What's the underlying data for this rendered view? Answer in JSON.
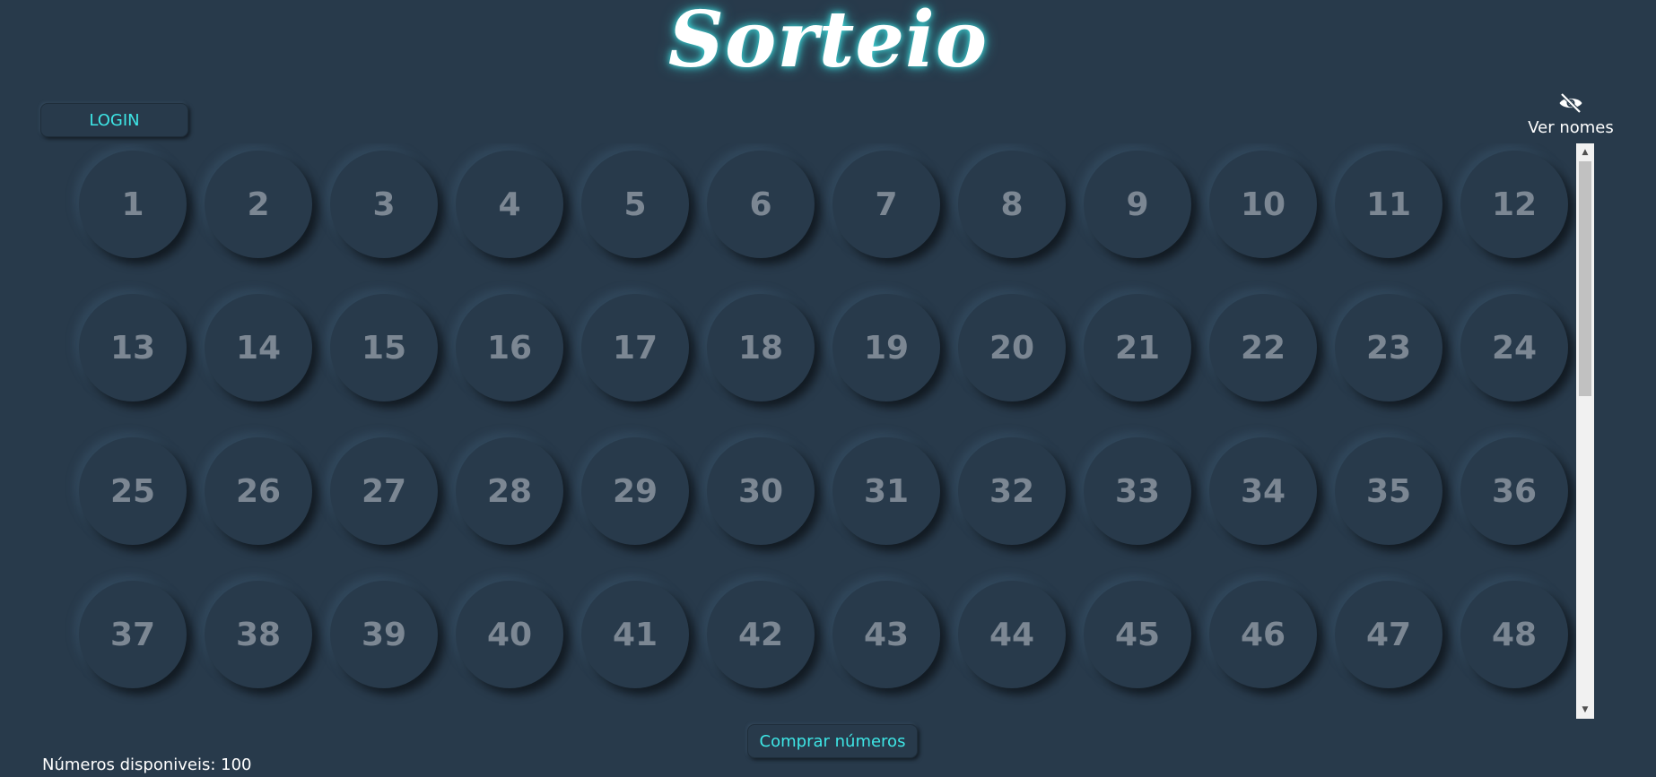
{
  "app": {
    "title": "Sorteio"
  },
  "header": {
    "login_label": "LOGIN",
    "toggle_names_label": "Ver nomes",
    "toggle_names_icon": "eye-off-icon"
  },
  "numbers": [
    1,
    2,
    3,
    4,
    5,
    6,
    7,
    8,
    9,
    10,
    11,
    12,
    13,
    14,
    15,
    16,
    17,
    18,
    19,
    20,
    21,
    22,
    23,
    24,
    25,
    26,
    27,
    28,
    29,
    30,
    31,
    32,
    33,
    34,
    35,
    36,
    37,
    38,
    39,
    40,
    41,
    42,
    43,
    44,
    45,
    46,
    47,
    48
  ],
  "footer": {
    "buy_label": "Comprar números",
    "available_text": "Números disponiveis: 100"
  },
  "colors": {
    "background": "#283a4b",
    "accent": "#3ee6e6",
    "number_text": "#7c8793"
  }
}
